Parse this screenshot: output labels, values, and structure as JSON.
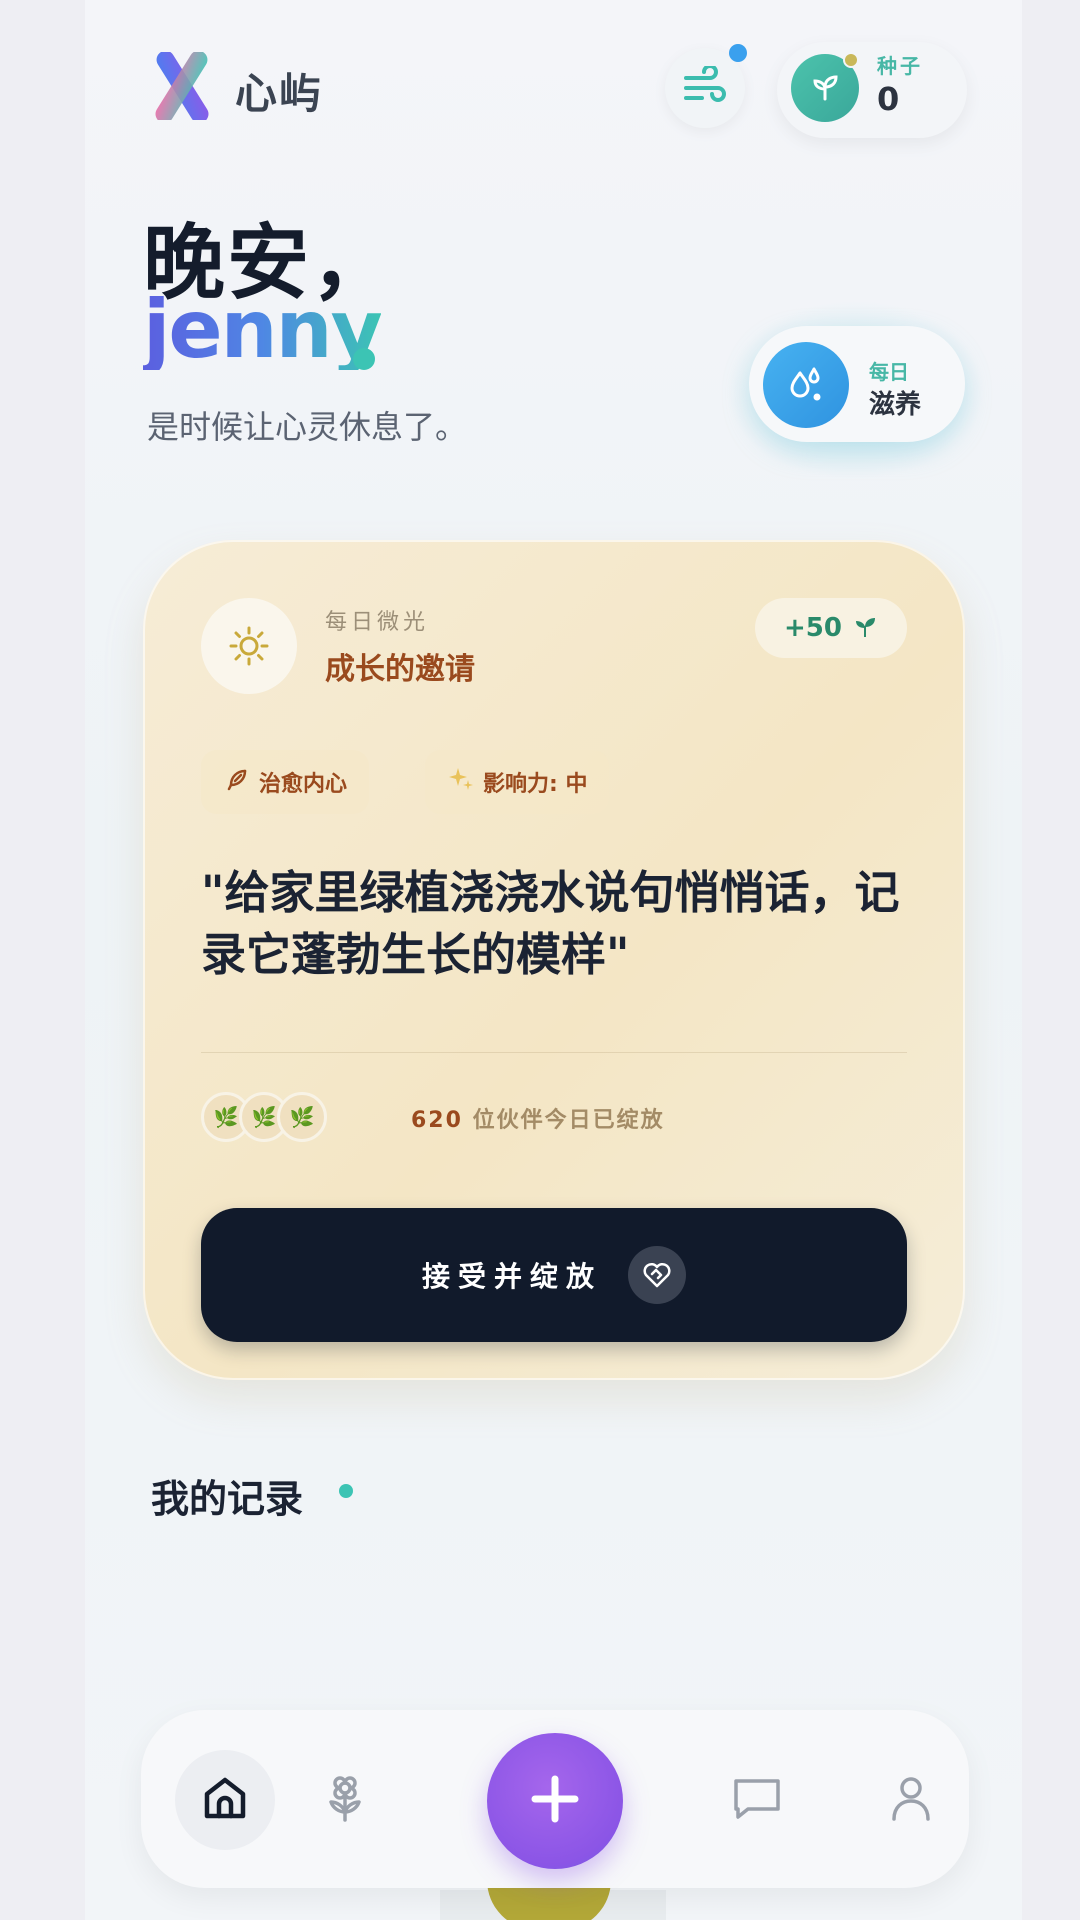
{
  "header": {
    "brand_name": "心屿",
    "seeds_label": "种子",
    "seeds_count": "0",
    "notification_color": "#3aa0ee"
  },
  "greeting": {
    "salutation": "晚安，",
    "username": "jenny",
    "subtitle": "是时候让心灵休息了。"
  },
  "nourish": {
    "line1": "每日",
    "line2": "滋养"
  },
  "daily_card": {
    "kicker": "每日微光",
    "title": "成长的邀请",
    "reward": "+50",
    "tags": [
      {
        "icon": "feather-icon",
        "label": "治愈内心"
      },
      {
        "icon": "sparkles-icon",
        "label": "影响力: 中"
      }
    ],
    "quote": "\"给家里绿植浇浇水说句悄悄话，记录它蓬勃生长的模样\"",
    "partners_count": "620",
    "partners_text": "位伙伴今日已绽放",
    "accept_label": "接受并绽放"
  },
  "records": {
    "title": "我的记录"
  },
  "nav": {
    "items": [
      "home-icon",
      "flower-icon",
      "plus-icon",
      "chat-icon",
      "profile-icon"
    ]
  },
  "colors": {
    "accent_teal": "#3cc4b4",
    "accent_purple": "#8b55e6",
    "button_dark": "#111a2b",
    "title_brown": "#9a4a1e"
  }
}
